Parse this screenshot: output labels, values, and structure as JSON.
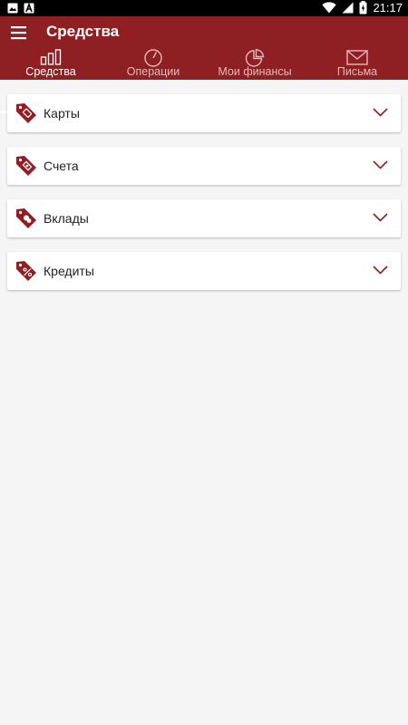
{
  "status_bar": {
    "time": "21:17",
    "icons": [
      "image-notification-icon",
      "font-notification-icon",
      "wifi-icon",
      "signal-icon",
      "battery-charging-icon"
    ]
  },
  "app_bar": {
    "title": "Средства",
    "menu_icon": "hamburger-menu-icon"
  },
  "tabs": [
    {
      "label": "Средства",
      "icon": "bar-chart-icon",
      "active": true
    },
    {
      "label": "Операции",
      "icon": "clock-icon",
      "active": false
    },
    {
      "label": "Мои финансы",
      "icon": "pie-chart-icon",
      "active": false
    },
    {
      "label": "Письма",
      "icon": "envelope-icon",
      "active": false
    }
  ],
  "sections": [
    {
      "label": "Карты",
      "icon": "card-tag-icon"
    },
    {
      "label": "Счета",
      "icon": "account-tag-icon"
    },
    {
      "label": "Вклады",
      "icon": "deposit-tag-icon"
    },
    {
      "label": "Кредиты",
      "icon": "percent-tag-icon"
    }
  ],
  "colors": {
    "primary": "#8e1f22",
    "background": "#f5f5f5",
    "card": "#ffffff",
    "status_bar": "#000000",
    "tab_inactive_text": "#e6b8b9"
  }
}
